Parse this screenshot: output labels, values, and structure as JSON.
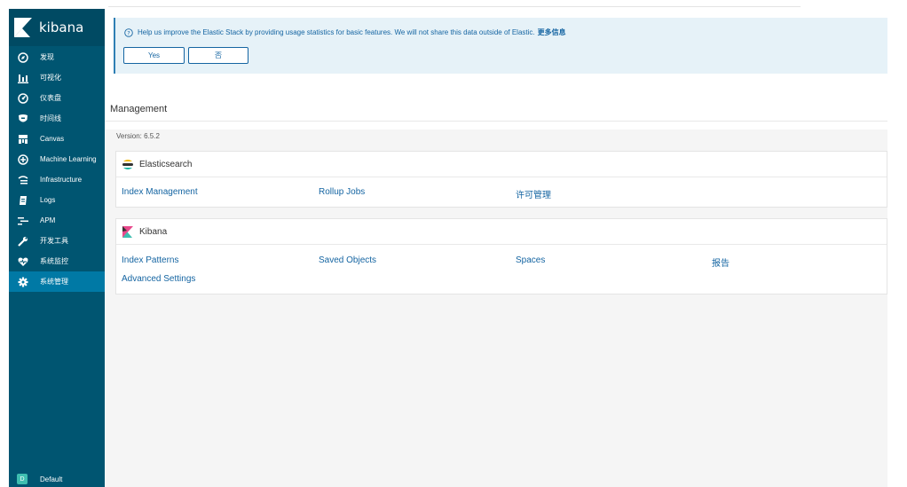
{
  "sidebar": {
    "brand": "kibana",
    "items": [
      {
        "label": "发现",
        "icon": "compass-icon",
        "active": false
      },
      {
        "label": "可视化",
        "icon": "bar-chart-icon",
        "active": false
      },
      {
        "label": "仪表盘",
        "icon": "dashboard-icon",
        "active": false
      },
      {
        "label": "时间线",
        "icon": "shield-icon",
        "active": false
      },
      {
        "label": "Canvas",
        "icon": "canvas-icon",
        "active": false
      },
      {
        "label": "Machine Learning",
        "icon": "machine-learning-icon",
        "active": false
      },
      {
        "label": "Infrastructure",
        "icon": "infrastructure-icon",
        "active": false
      },
      {
        "label": "Logs",
        "icon": "logs-icon",
        "active": false
      },
      {
        "label": "APM",
        "icon": "apm-icon",
        "active": false
      },
      {
        "label": "开发工具",
        "icon": "wrench-icon",
        "active": false
      },
      {
        "label": "系统监控",
        "icon": "heartbeat-icon",
        "active": false
      },
      {
        "label": "系统管理",
        "icon": "gear-icon",
        "active": true
      }
    ],
    "space": {
      "avatar": "D",
      "label": "Default"
    }
  },
  "banner": {
    "text": "Help us improve the Elastic Stack by providing usage statistics for basic features. We will not share this data outside of Elastic.",
    "link": "更多信息",
    "yes_label": "Yes",
    "no_label": "否"
  },
  "management": {
    "title": "Management",
    "version": "Version: 6.5.2"
  },
  "elasticsearch": {
    "title": "Elasticsearch",
    "links": [
      "Index Management",
      "Rollup Jobs",
      "许可管理"
    ]
  },
  "kibana": {
    "title": "Kibana",
    "links": [
      "Index Patterns",
      "Saved Objects",
      "Spaces",
      "报告",
      "Advanced Settings"
    ]
  },
  "colors": {
    "sidebar": "#005571",
    "sidebar_active": "#0079a5",
    "link": "#1565a2",
    "banner_bg": "#e6f2f8"
  }
}
